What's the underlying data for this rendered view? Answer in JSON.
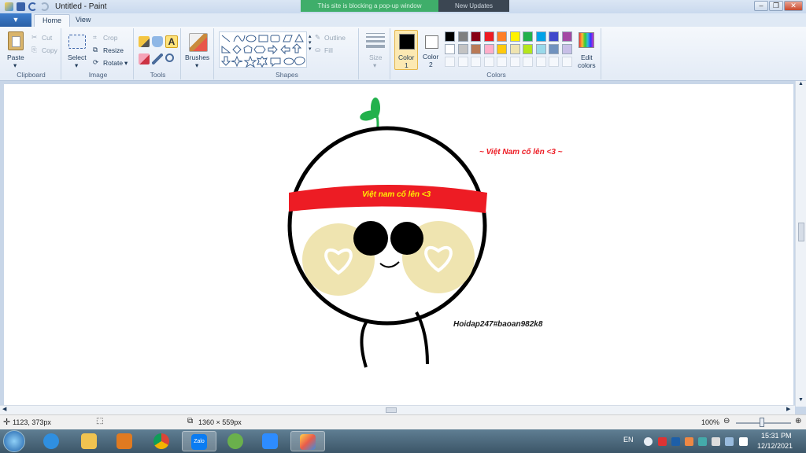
{
  "window": {
    "title": "Untitled - Paint",
    "notif_green": "This site is blocking a pop-up window",
    "notif_dark": "New Updates"
  },
  "tabs": {
    "file": "▼",
    "home": "Home",
    "view": "View"
  },
  "ribbon": {
    "clipboard": {
      "label": "Clipboard",
      "paste": "Paste",
      "cut": "Cut",
      "copy": "Copy"
    },
    "image": {
      "label": "Image",
      "select": "Select",
      "crop": "Crop",
      "resize": "Resize",
      "rotate": "Rotate"
    },
    "tools": {
      "label": "Tools"
    },
    "brushes": {
      "label": "Brushes"
    },
    "shapes": {
      "label": "Shapes",
      "outline": "Outline",
      "fill": "Fill"
    },
    "size": {
      "label": "Size"
    },
    "colors": {
      "label": "Colors",
      "color1": "Color",
      "color1_num": "1",
      "color2": "Color",
      "color2_num": "2",
      "edit_colors": "Edit",
      "edit_colors2": "colors",
      "color1_value": "#000000",
      "color2_value": "#ffffff",
      "palette_row1": [
        "#000000",
        "#7f7f7f",
        "#880015",
        "#ed1c24",
        "#ff7f27",
        "#fff200",
        "#22b14c",
        "#00a2e8",
        "#3f48cc",
        "#a349a4"
      ],
      "palette_row2": [
        "#ffffff",
        "#c3c3c3",
        "#b97a57",
        "#ffaec9",
        "#ffc90e",
        "#efe4b0",
        "#b5e61d",
        "#99d9ea",
        "#7092be",
        "#c8bfe7"
      ]
    }
  },
  "drawing": {
    "headband_text": "Việt nam cố lên <3",
    "side_text": "~ Việt Nam cố lên <3 ~",
    "signature": "Hoidap247#baoan982k8",
    "headband_color": "#ed1c24",
    "headband_text_color": "#fff200",
    "leaf_color": "#22b14c",
    "cheek_color": "#efe4b0"
  },
  "status": {
    "cursor_pos": "1123, 373px",
    "canvas_size": "1360 × 559px",
    "zoom": "100%"
  },
  "taskbar": {
    "lang": "EN",
    "time": "15:31 PM",
    "date": "12/12/2021",
    "zalo": "Zalo"
  }
}
